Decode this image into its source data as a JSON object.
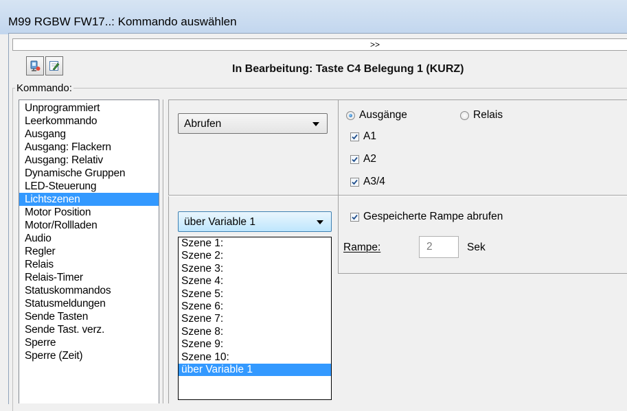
{
  "window": {
    "title": "M99 RGBW FW17..: Kommando auswählen"
  },
  "expander": {
    "label": ">>"
  },
  "header": {
    "edit_title": "In Bearbeitung: Taste C4 Belegung 1 (KURZ)"
  },
  "command_group": {
    "label": "Kommando:",
    "items": [
      "Unprogrammiert",
      "Leerkommando",
      "Ausgang",
      "Ausgang: Flackern",
      "Ausgang: Relativ",
      "Dynamische Gruppen",
      "LED-Steuerung",
      "Lichtszenen",
      "Motor Position",
      "Motor/Rollladen",
      "Audio",
      "Regler",
      "Relais",
      "Relais-Timer",
      "Statuskommandos",
      "Statusmeldungen",
      "Sende Tasten",
      "Sende Tast. verz.",
      "Sperre",
      "Sperre (Zeit)"
    ],
    "selected": "Lichtszenen"
  },
  "action_combo": {
    "value": "Abrufen"
  },
  "target": {
    "radio_outputs": "Ausgänge",
    "radio_relais": "Relais",
    "selected": "Ausgänge",
    "checkboxes": [
      {
        "label": "A1",
        "checked": true
      },
      {
        "label": "A2",
        "checked": true
      },
      {
        "label": "A3/4",
        "checked": true
      }
    ]
  },
  "scene_combo": {
    "value": "über Variable 1",
    "options": [
      "Szene 1:",
      "Szene 2:",
      "Szene 3:",
      "Szene 4:",
      "Szene 5:",
      "Szene 6:",
      "Szene 7:",
      "Szene 8:",
      "Szene 9:",
      "Szene 10:",
      "über Variable 1"
    ],
    "selected": "über Variable 1"
  },
  "ramp": {
    "checkbox_label": "Gespeicherte Rampe abrufen",
    "checked": true,
    "label": "Rampe:",
    "value": "2",
    "unit": "Sek"
  }
}
